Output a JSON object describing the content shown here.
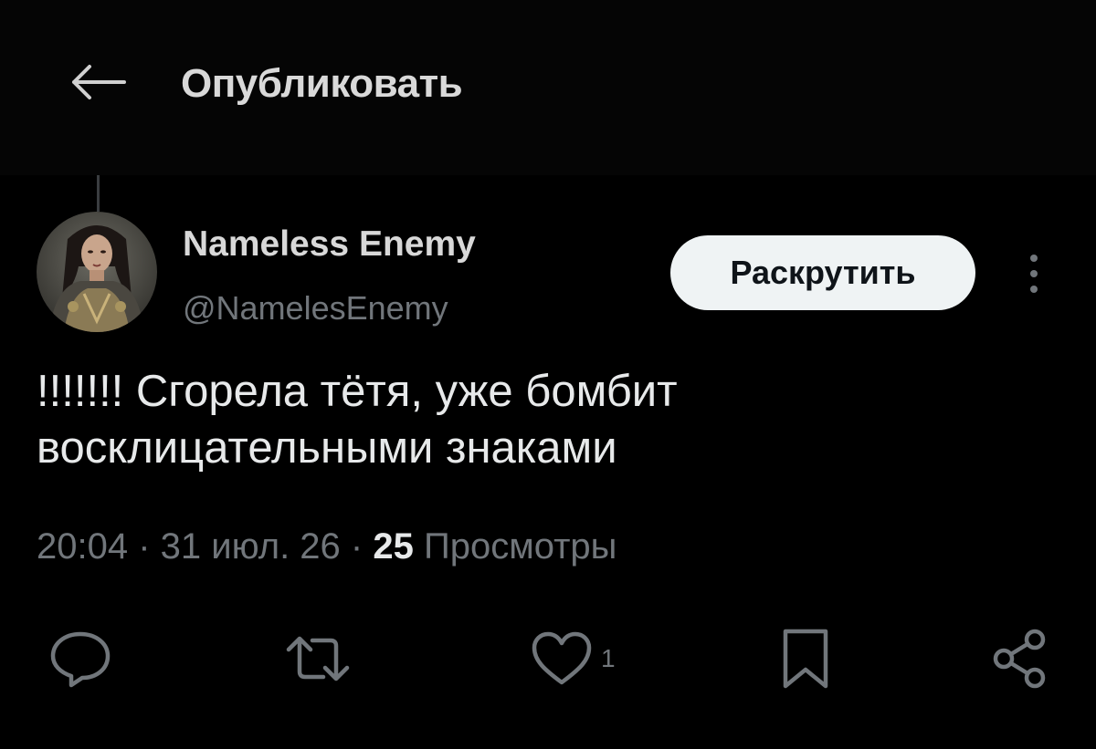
{
  "header": {
    "back_icon": "arrow-left-icon",
    "title": "Опубликовать"
  },
  "author": {
    "display_name": "Nameless Enemy",
    "handle": "@NamelesEnemy",
    "avatar": "avatar-image"
  },
  "follow_button": {
    "label": "Раскрутить"
  },
  "more_icon": "more-vertical-icon",
  "tweet": {
    "text": "!!!!!!! Сгорела тётя, уже бомбит восклицательными знаками",
    "time": "20:04",
    "sep1": " · ",
    "date": "31 июл. 26",
    "sep2": " · ",
    "views_count": "25",
    "views_label": "Просмотры"
  },
  "actions": {
    "reply_icon": "reply-icon",
    "repost_icon": "repost-icon",
    "like_icon": "heart-icon",
    "like_count": "1",
    "bookmark_icon": "bookmark-icon",
    "share_icon": "share-icon"
  },
  "colors": {
    "background": "#000000",
    "text_primary": "#e7e9ea",
    "text_secondary": "#71767b",
    "button_bg": "#eff3f4",
    "button_text": "#0f1419"
  }
}
